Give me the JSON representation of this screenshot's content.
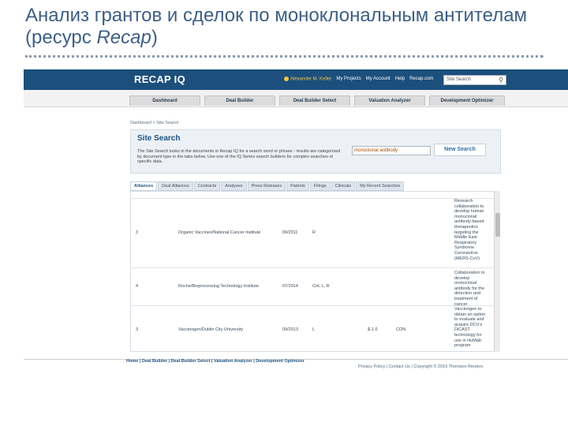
{
  "slide": {
    "title_plain": "Анализ грантов и сделок по моноклональным антителам (ресурс ",
    "title_em": "Recap",
    "title_close": ")"
  },
  "header": {
    "logo": "RECAP IQ",
    "user": "Alexander M. Keller",
    "links": [
      "My Projects",
      "My Account",
      "Help",
      "Recap.com"
    ],
    "search_placeholder": "Site Search"
  },
  "nav_tabs": [
    "Dashboard",
    "Deal Builder",
    "Deal Builder Select",
    "Valuation Analyzer",
    "Development Optimizer"
  ],
  "breadcrumb": "Dashboard > Site Search",
  "site_search": {
    "title": "Site Search",
    "description": "The Site Search looks in the documents in Recap IQ for a search word or phrase - results are categorized by document type in the tabs below. Use one of the IQ Series search builders for complex searches of specific data.",
    "query": "monoclonal antibody",
    "button": "New Search"
  },
  "result_tabs": [
    "Alliances",
    "Deal Alliances",
    "Contracts",
    "Analyses",
    "Press Releases",
    "Patents",
    "Filings",
    "Clinicals",
    "My Recent Searches"
  ],
  "rows": [
    {
      "num": "",
      "parties": "",
      "date": "",
      "stage": "",
      "value": "",
      "type": "",
      "desc": ""
    },
    {
      "num": "3",
      "parties": "Organic Vaccines/National Cancer Institute",
      "date": "09/2011",
      "stage": "R",
      "value": "",
      "type": "",
      "desc": "Research collaboration to develop human monoclonal antibody-based therapeutics targeting the Middle East Respiratory Syndrome Coronavirus (MERS-CoV)"
    },
    {
      "num": "4",
      "parties": "Roche/Bioprocessing Technology Institute",
      "date": "07/2014",
      "stage": "Cnt, L, R",
      "value": "",
      "type": "",
      "desc": "Collaboration to develop monoclonal antibody for the detection and treatment of cancer"
    },
    {
      "num": "3",
      "parties": "Vaccinogen/Dublin City University",
      "date": "09/2013",
      "stage": "L",
      "value": "$-1.0",
      "type": "CON",
      "desc": "Vaccinogen to obtain an option to evaluate and acquire DCU's DiCAST technology for use in HuMab program"
    }
  ],
  "footer": {
    "links": "Home | Deal Builder | Deal Builder Select | Valuation Analyzer | Development Optimizer",
    "right": "Privacy Policy | Contact Us | Copyright © 2015 Thomson Reuters"
  }
}
